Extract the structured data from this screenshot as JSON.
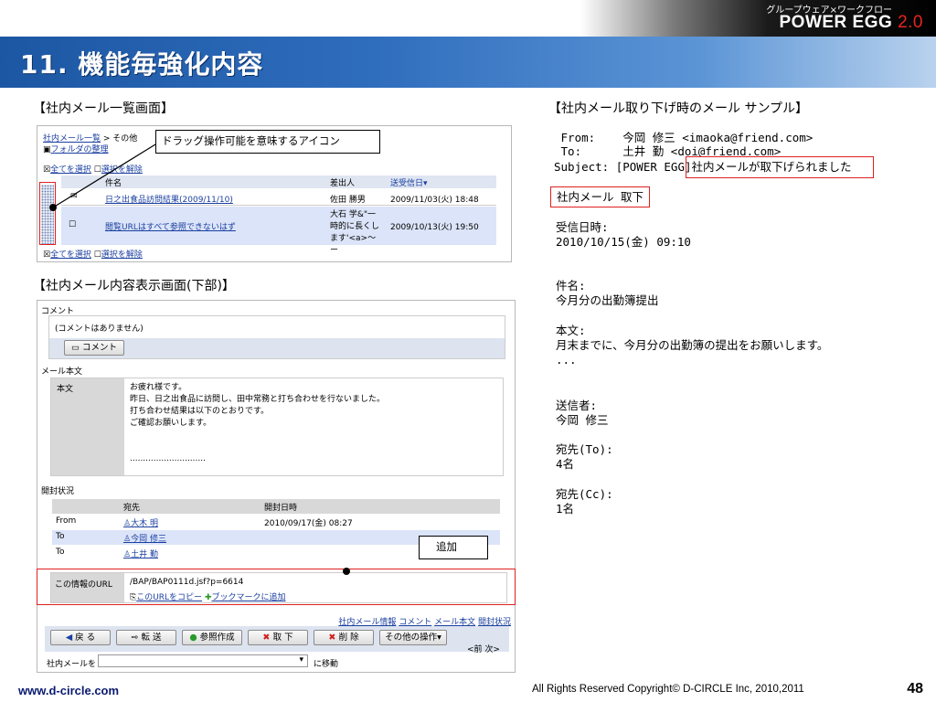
{
  "brand": {
    "sub": "グループウェア×ワークフロー",
    "name": "POWER EGG",
    "version": "2.0"
  },
  "slide": {
    "title": "11. 機能毎強化内容",
    "page_number": "48"
  },
  "list_section": {
    "label": "【社内メール一覧画面】",
    "breadcrumb_link": "社内メール一覧",
    "breadcrumb_rest": " > その他",
    "folder_link": "フォルダの整理",
    "select_all": "全てを選択",
    "deselect": "選択を解除",
    "columns": [
      "件名",
      "差出人",
      "送受信日"
    ],
    "sort_mark": "▾",
    "rows": [
      {
        "subject": "日之出食品訪問結果(2009/11/10)",
        "sender": "佐田 勝男",
        "date": "2009/11/03(火) 18:48"
      },
      {
        "subject": "閲覧URLはすべて参照できないはず",
        "sender": "大石 学&\"一時的に長くします'<a>〜ー",
        "date": "2009/10/13(火) 19:50"
      }
    ],
    "callout": "ドラッグ操作可能を意味するアイコン"
  },
  "detail_section": {
    "label": "【社内メール内容表示画面(下部)】",
    "comment_header": "コメント",
    "no_comment": "(コメントはありません)",
    "comment_button": "コメント",
    "body_header": "メール本文",
    "body_label": "本文",
    "body_lines": [
      "お疲れ様です。",
      "昨日、日之出食品に訪問し、田中常務と打ち合わせを行ないました。",
      "打ち合わせ結果は以下のとおりです。",
      "ご確認お願いします。",
      "",
      "",
      "............................."
    ],
    "open_header": "開封状況",
    "open_columns": [
      "宛先",
      "開封日時"
    ],
    "open_rows": [
      {
        "type": "From",
        "name": "大木 明",
        "date": "2010/09/17(金) 08:27"
      },
      {
        "type": "To",
        "name": "今岡 修三",
        "date": ""
      },
      {
        "type": "To",
        "name": "土井 勤",
        "date": ""
      }
    ],
    "url_label": "この情報のURL",
    "url_value": "/BAP/BAP0111d.jsf?p=6614",
    "copy_url": "このURLをコピー",
    "add_bookmark": "ブックマークに追加",
    "added_callout": "追加",
    "bottom_links": [
      "社内メール情報",
      "コメント",
      "メール本文",
      "開封状況"
    ],
    "buttons": [
      "戻 る",
      "転 送",
      "参照作成",
      "取 下",
      "削 除",
      "その他の操作"
    ],
    "prev": "<前",
    "next": "次>",
    "move_label": "社内メールを",
    "move_suffix": "に移動"
  },
  "sample_section": {
    "label": "【社内メール取り下げ時のメール サンプル】",
    "from_line": " From:    今岡 修三 <imaoka@friend.com>",
    "to_line": " To:      土井 勤 <doi@friend.com>",
    "subject_prefix": "Subject: [POWER EGG]",
    "subject_text": "社内メールが取下げられました",
    "badge": "社内メール 取下",
    "received_label": "受信日時:",
    "received_value": "2010/10/15(金) 09:10",
    "title_label": "件名:",
    "title_value": "今月分の出勤簿提出",
    "body_label": "本文:",
    "body_value": "月末までに、今月分の出勤簿の提出をお願いします。",
    "ellipsis": "...",
    "sender_label": "送信者:",
    "sender_value": "今岡 修三",
    "to_label": "宛先(To):",
    "to_value": "4名",
    "cc_label": "宛先(Cc):",
    "cc_value": "1名"
  },
  "footer": {
    "site": "www.d-circle.com",
    "copyright": "All Rights Reserved Copyright© D-CIRCLE  Inc, 2010,2011"
  },
  "colors": {
    "title_bar": "#2f6dbd",
    "highlight_red": "#e02020",
    "link_blue": "#1a3fa0"
  }
}
